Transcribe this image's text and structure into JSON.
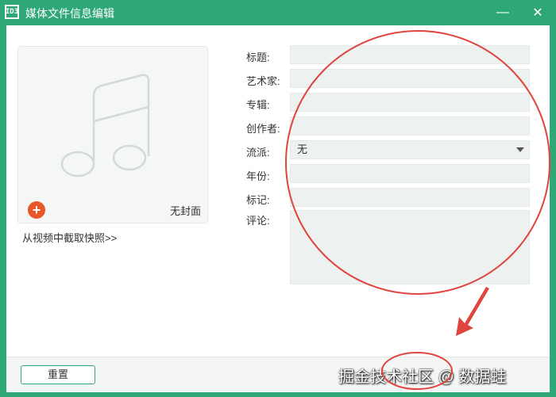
{
  "window": {
    "title": "媒体文件信息编辑",
    "app_icon_text": "ID3",
    "minimize_glyph": "—",
    "close_glyph": "✕"
  },
  "cover": {
    "no_cover_label": "无封面",
    "add_glyph": "+",
    "snapshot_link": "从视频中截取快照>>"
  },
  "fields": {
    "title_label": "标题:",
    "title_value": "",
    "artist_label": "艺术家:",
    "artist_value": "",
    "album_label": "专辑:",
    "album_value": "",
    "composer_label": "创作者:",
    "composer_value": "",
    "genre_label": "流派:",
    "genre_value": "无",
    "year_label": "年份:",
    "year_value": "",
    "tag_label": "标记:",
    "tag_value": "",
    "comment_label": "评论:",
    "comment_value": ""
  },
  "footer": {
    "reset_label": "重置",
    "watermark": "掘金技术社区 @ 数据蛙"
  },
  "colors": {
    "brand": "#2fa877",
    "field_bg": "#edf1ef",
    "add_button": "#e8572a",
    "annotation": "#e0443e"
  },
  "icons": {
    "cover_placeholder": "music-note-icon",
    "add": "plus-icon",
    "genre_dropdown": "caret-down-icon"
  }
}
